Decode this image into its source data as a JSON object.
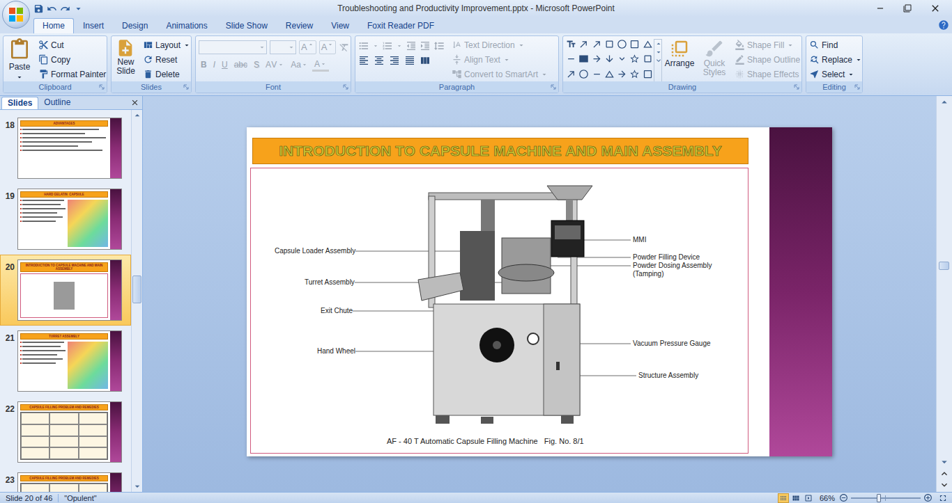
{
  "window": {
    "title": "Troubleshooting and Productivity Improvement.pptx - Microsoft PowerPoint"
  },
  "ribbon": {
    "tabs": [
      {
        "label": "Home",
        "selected": true
      },
      {
        "label": "Insert",
        "selected": false
      },
      {
        "label": "Design",
        "selected": false
      },
      {
        "label": "Animations",
        "selected": false
      },
      {
        "label": "Slide Show",
        "selected": false
      },
      {
        "label": "Review",
        "selected": false
      },
      {
        "label": "View",
        "selected": false
      },
      {
        "label": "Foxit Reader PDF",
        "selected": false
      }
    ],
    "clipboard": {
      "label": "Clipboard",
      "paste": "Paste",
      "items": [
        {
          "label": "Cut",
          "disabled": false
        },
        {
          "label": "Copy",
          "disabled": false
        },
        {
          "label": "Format Painter",
          "disabled": false
        }
      ]
    },
    "slides": {
      "label": "Slides",
      "new_slide": "New Slide",
      "items": [
        {
          "label": "Layout",
          "disabled": false,
          "dropdown": true
        },
        {
          "label": "Reset",
          "disabled": false,
          "dropdown": false
        },
        {
          "label": "Delete",
          "disabled": false,
          "dropdown": false
        }
      ]
    },
    "font": {
      "label": "Font",
      "disabled": true,
      "size_buttons": [
        "A",
        "A"
      ],
      "format_buttons": [
        "B",
        "I",
        "U",
        "abc",
        "S",
        "AV",
        "Aa",
        "A"
      ]
    },
    "paragraph": {
      "label": "Paragraph",
      "items": [
        {
          "label": "Text Direction",
          "disabled": true,
          "dropdown": true
        },
        {
          "label": "Align Text",
          "disabled": true,
          "dropdown": true
        },
        {
          "label": "Convert to SmartArt",
          "disabled": true,
          "dropdown": true
        }
      ]
    },
    "drawing": {
      "label": "Drawing",
      "big": [
        {
          "label": "Arrange",
          "disabled": false
        },
        {
          "label": "Quick Styles",
          "disabled": true
        }
      ],
      "items": [
        {
          "label": "Shape Fill",
          "disabled": true,
          "dropdown": true
        },
        {
          "label": "Shape Outline",
          "disabled": true,
          "dropdown": true
        },
        {
          "label": "Shape Effects",
          "disabled": true,
          "dropdown": true
        }
      ]
    },
    "editing": {
      "label": "Editing",
      "items": [
        {
          "label": "Find",
          "disabled": false,
          "dropdown": false
        },
        {
          "label": "Replace",
          "disabled": false,
          "dropdown": true
        },
        {
          "label": "Select",
          "disabled": false,
          "dropdown": true
        }
      ]
    }
  },
  "slides_panel": {
    "tabs": [
      {
        "label": "Slides",
        "selected": true
      },
      {
        "label": "Outline",
        "selected": false
      }
    ],
    "scroll_level": 0.43,
    "thumbnails": [
      {
        "number": "18",
        "title": "ADVANTAGES",
        "kind": "bullets",
        "selected": false
      },
      {
        "number": "19",
        "title": "HARD GELATIN  CAPSULE",
        "kind": "mixed",
        "selected": false
      },
      {
        "number": "20",
        "title": "INTRODUCTION TO CAPSULE MACHINE AND MAIN ASSEMBLY",
        "kind": "figure",
        "selected": true
      },
      {
        "number": "21",
        "title": "TURRET ASSEMBLY",
        "kind": "mixed",
        "selected": false
      },
      {
        "number": "22",
        "title": "CAPSULE FILLING PROBLEM AND REMEDIES",
        "kind": "table",
        "selected": false
      },
      {
        "number": "23",
        "title": "CAPSULE FILLING PROBLEM AND REMEDIES",
        "kind": "table",
        "selected": false
      }
    ]
  },
  "slide": {
    "title": "INTRODUCTION TO CAPSULE MACHINE AND MAIN ASSEMBLY",
    "figure": {
      "labels": [
        {
          "text": "Capsule Loader Assembly",
          "side": "left"
        },
        {
          "text": "Turret Assembly",
          "side": "left"
        },
        {
          "text": "Exit Chute",
          "side": "left"
        },
        {
          "text": "Hand Wheel",
          "side": "left"
        },
        {
          "text": "MMI",
          "side": "right"
        },
        {
          "text": "Powder Filling Device",
          "side": "right"
        },
        {
          "text": "Powder Dosing Assembly (Tamping)",
          "side": "right"
        },
        {
          "text": "Vacuum Pressure Gauge",
          "side": "right"
        },
        {
          "text": "Structure Assembly",
          "side": "right"
        }
      ],
      "caption": "AF - 40 T Automatic Capsule Filling Machine   Fig. No. 8/1"
    }
  },
  "editor_scroll": {
    "level": 0.44
  },
  "status_bar": {
    "slide_info": "Slide 20 of 46",
    "theme": "\"Opulent\"",
    "views": [
      {
        "selected": true
      },
      {
        "selected": false
      },
      {
        "selected": false
      }
    ],
    "zoom": "66%",
    "zoom_level": 0.4
  }
}
